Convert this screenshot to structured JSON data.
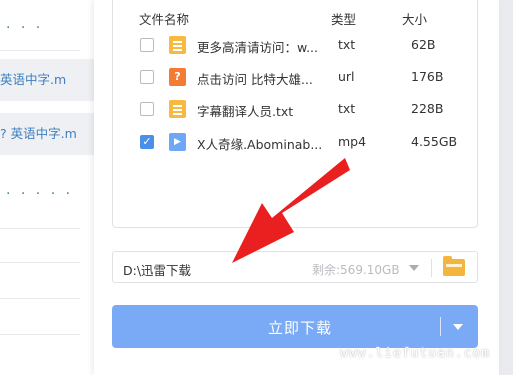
{
  "background": {
    "rows": [
      {
        "text": "· · ·",
        "kind": "dots"
      },
      {
        "text": "英语中字.m",
        "kind": "link"
      },
      {
        "text": "? 英语中字.m",
        "kind": "link"
      },
      {
        "text": "· · · · ·",
        "kind": "dots"
      }
    ]
  },
  "file_list": {
    "headers": {
      "name": "文件名称",
      "type": "类型",
      "size": "大小"
    },
    "rows": [
      {
        "checked": false,
        "icon": "txt-file-icon",
        "name": "更多高清请访问：w...",
        "type": "txt",
        "size": "62B"
      },
      {
        "checked": false,
        "icon": "url-file-icon",
        "name": "点击访问 比特大雄...",
        "type": "url",
        "size": "176B"
      },
      {
        "checked": false,
        "icon": "txt-file-icon",
        "name": "字幕翻译人员.txt",
        "type": "txt",
        "size": "228B"
      },
      {
        "checked": true,
        "icon": "video-file-icon",
        "name": "X人奇缘.Abominab...",
        "type": "mp4",
        "size": "4.55GB"
      }
    ]
  },
  "save_path": {
    "value": "D:\\迅雷下载",
    "free_space": "剩余:569.10GB",
    "folder_icon": "folder-icon"
  },
  "download_button": {
    "label": "立即下载",
    "dropdown_icon": "chevron-down-icon"
  },
  "watermark": "www.liefutuan.com",
  "colors": {
    "accent": "#7aaaf6",
    "arrow": "#ea1f1f",
    "folder": "#f4b53e"
  }
}
